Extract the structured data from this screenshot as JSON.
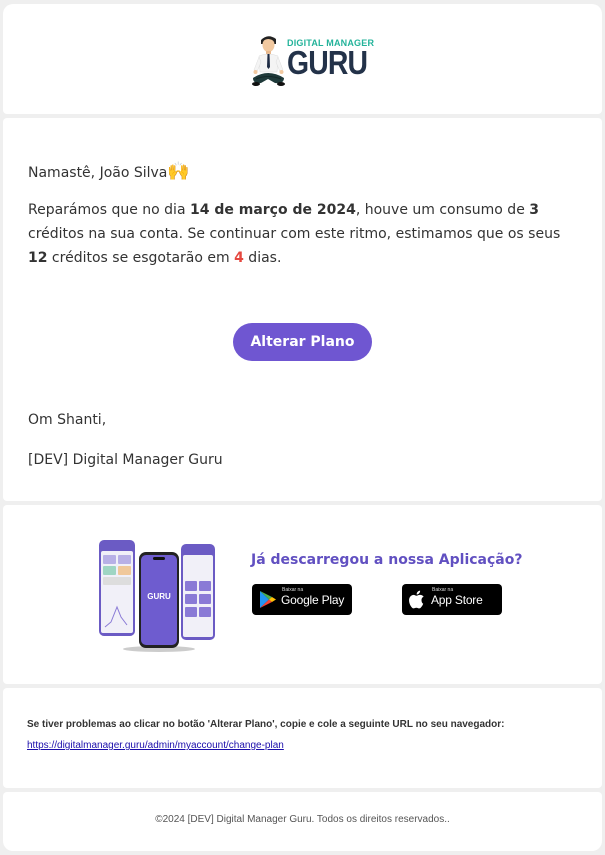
{
  "logo": {
    "top_text": "DIGITAL MANAGER",
    "main_text": "GURU",
    "icon": "meditating-man-icon"
  },
  "email": {
    "greeting": "Namastê, João Silva",
    "greeting_emoji": "🙌",
    "message": {
      "p1": "Reparámos que no dia ",
      "date": "14 de março de 2024",
      "p2": ", houve um consumo de ",
      "consumed": "3",
      "p3": " créditos na sua conta. Se continuar com este ritmo, estimamos que os seus ",
      "credits": "12",
      "p4": " créditos se esgotarão em ",
      "days": "4",
      "p5": " dias."
    },
    "button_label": "Alterar Plano",
    "signoff": "Om Shanti,",
    "signature": "[DEV] Digital Manager Guru"
  },
  "app_section": {
    "title": "Já descarregou a nossa Aplicação?",
    "phone_logo": "GURU",
    "google_play": {
      "small": "Baixar na",
      "big": "Google Play"
    },
    "app_store": {
      "small": "Baixar na",
      "big": "App Store"
    }
  },
  "help": {
    "text": "Se tiver problemas ao clicar no botão 'Alterar Plano', copie e cole a seguinte URL no seu navegador:",
    "link": "https://digitalmanager.guru/admin/myaccount/change-plan"
  },
  "footer": {
    "text": "©2024 [DEV] Digital Manager Guru. Todos os direitos reservados.."
  },
  "colors": {
    "accent": "#6f56d1",
    "title_purple": "#6150c1",
    "logo_green": "#23b39a",
    "logo_navy": "#233249",
    "highlight_red": "#e5483f"
  }
}
